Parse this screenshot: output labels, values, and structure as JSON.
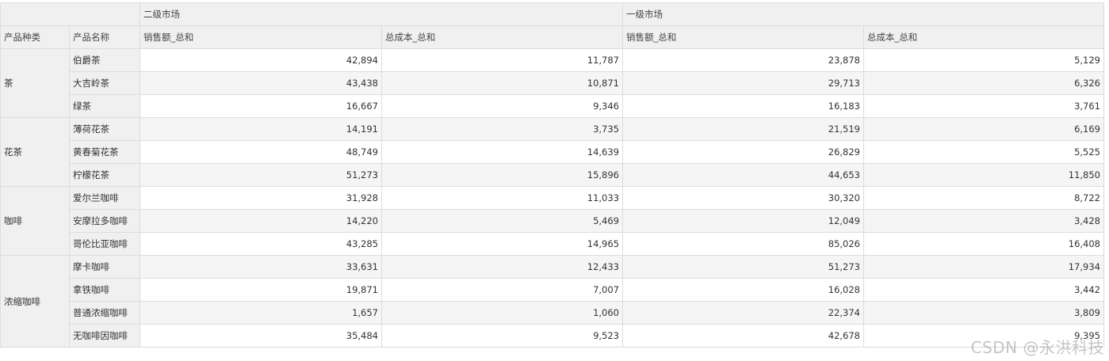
{
  "header": {
    "corner": "",
    "markets": [
      "二级市场",
      "一级市场"
    ],
    "dimensions": [
      "产品种类",
      "产品名称"
    ],
    "measures": [
      "销售额_总和",
      "总成本_总和",
      "销售额_总和",
      "总成本_总和"
    ]
  },
  "rows": [
    {
      "category": "茶",
      "span": 3,
      "name": "伯爵茶",
      "values": [
        "42,894",
        "11,787",
        "23,878",
        "5,129"
      ]
    },
    {
      "category": "",
      "name": "大吉岭茶",
      "values": [
        "43,438",
        "10,871",
        "29,713",
        "6,326"
      ]
    },
    {
      "category": "",
      "name": "绿茶",
      "values": [
        "16,667",
        "9,346",
        "16,183",
        "3,761"
      ]
    },
    {
      "category": "花茶",
      "span": 3,
      "name": "薄荷花茶",
      "values": [
        "14,191",
        "3,735",
        "21,519",
        "6,169"
      ]
    },
    {
      "category": "",
      "name": "黄春菊花茶",
      "values": [
        "48,749",
        "14,639",
        "26,829",
        "5,525"
      ]
    },
    {
      "category": "",
      "name": "柠檬花茶",
      "values": [
        "51,273",
        "15,896",
        "44,653",
        "11,850"
      ]
    },
    {
      "category": "咖啡",
      "span": 3,
      "name": "爱尔兰咖啡",
      "values": [
        "31,928",
        "11,033",
        "30,320",
        "8,722"
      ]
    },
    {
      "category": "",
      "name": "安摩拉多咖啡",
      "values": [
        "14,220",
        "5,469",
        "12,049",
        "3,428"
      ]
    },
    {
      "category": "",
      "name": "哥伦比亚咖啡",
      "values": [
        "43,285",
        "14,965",
        "85,026",
        "16,408"
      ]
    },
    {
      "category": "浓缩咖啡",
      "span": 4,
      "name": "摩卡咖啡",
      "values": [
        "33,631",
        "12,433",
        "51,273",
        "17,934"
      ]
    },
    {
      "category": "",
      "name": "拿铁咖啡",
      "values": [
        "19,871",
        "7,007",
        "16,028",
        "3,442"
      ]
    },
    {
      "category": "",
      "name": "普通浓缩咖啡",
      "values": [
        "1,657",
        "1,060",
        "22,374",
        "3,809"
      ]
    },
    {
      "category": "",
      "name": "无咖啡因咖啡",
      "values": [
        "35,484",
        "9,523",
        "42,678",
        "9,395"
      ]
    }
  ],
  "watermark": "CSDN @永洪科技"
}
